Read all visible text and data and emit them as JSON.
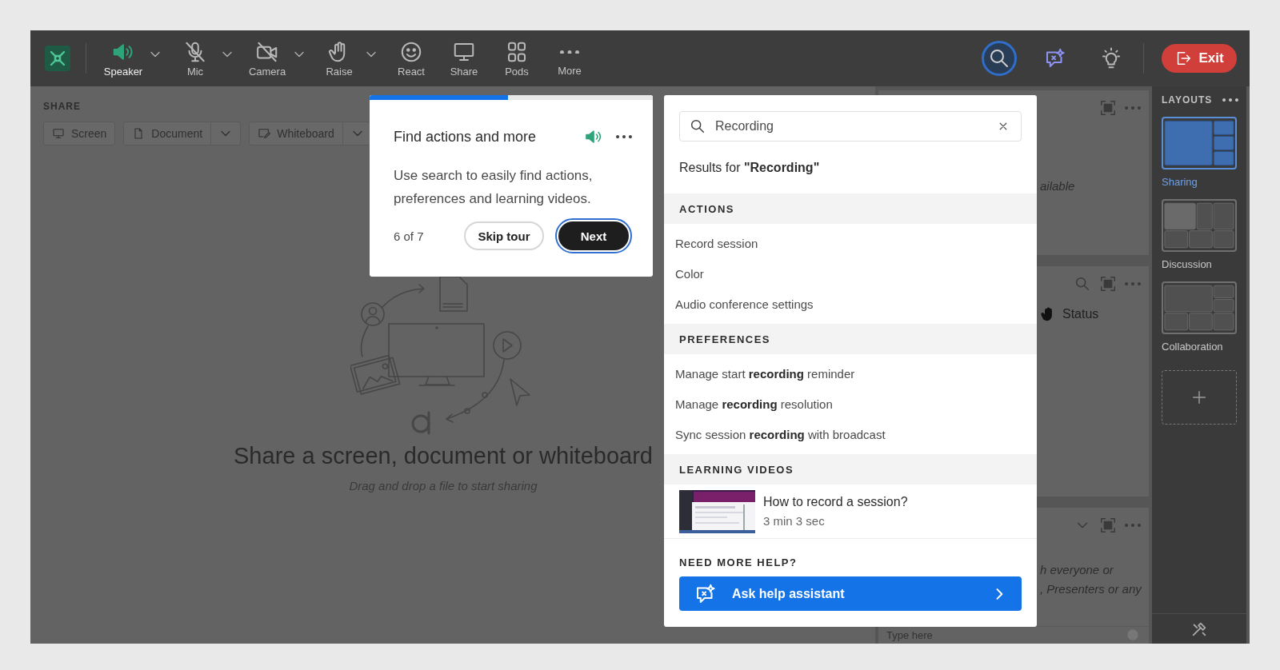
{
  "toolbar": {
    "items": [
      {
        "label": "Speaker",
        "kind": "speaker",
        "on": true,
        "has_menu": true
      },
      {
        "label": "Mic",
        "kind": "mic",
        "on": false,
        "has_menu": true
      },
      {
        "label": "Camera",
        "kind": "camera",
        "on": false,
        "has_menu": true
      },
      {
        "label": "Raise",
        "kind": "raise",
        "has_menu": true
      },
      {
        "label": "React",
        "kind": "react",
        "has_menu": false
      },
      {
        "label": "Share",
        "kind": "share",
        "has_menu": false
      },
      {
        "label": "Pods",
        "kind": "pods",
        "has_menu": false
      },
      {
        "label": "More",
        "kind": "more",
        "has_menu": false
      }
    ],
    "tools": [
      {
        "kind": "search",
        "selected": true
      },
      {
        "kind": "assistant",
        "selected": false
      },
      {
        "kind": "tips",
        "selected": false
      }
    ],
    "exit": "Exit"
  },
  "share": {
    "title": "SHARE",
    "buttons": [
      {
        "label": "Screen",
        "kind": "screen",
        "has_menu": false
      },
      {
        "label": "Document",
        "kind": "document",
        "has_menu": true
      },
      {
        "label": "Whiteboard",
        "kind": "whiteboard",
        "has_menu": true
      }
    ],
    "empty_title": "Share a screen, document or whiteboard",
    "empty_hint": "Drag and drop a file to start sharing"
  },
  "pods": [
    {
      "controls": [
        {
          "kind": "fullscreen"
        },
        {
          "kind": "more"
        }
      ],
      "lines": [
        "ailable"
      ]
    },
    {
      "controls": [
        {
          "kind": "search"
        },
        {
          "kind": "fullscreen"
        },
        {
          "kind": "more"
        }
      ],
      "status": "Status"
    },
    {
      "controls": [
        {
          "kind": "collapse"
        },
        {
          "kind": "fullscreen"
        },
        {
          "kind": "more"
        }
      ],
      "lines": [
        "h everyone or",
        ", Presenters or any"
      ],
      "input": {
        "placeholder": "Type here"
      }
    }
  ],
  "layouts": {
    "title": "LAYOUTS",
    "items": [
      {
        "label": "Sharing",
        "kind": "sharing",
        "selected": true
      },
      {
        "label": "Discussion",
        "kind": "discussion",
        "selected": false
      },
      {
        "label": "Collaboration",
        "kind": "collaboration",
        "selected": false
      }
    ]
  },
  "tour": {
    "level": 0.49,
    "title": "Find actions and more",
    "body": "Use search to easily find actions, preferences and learning videos.",
    "step": "6 of 7",
    "skip": "Skip tour",
    "next": "Next"
  },
  "search": {
    "query": "Recording",
    "results_title": "Results for **\"Recording\"**",
    "sections": [
      {
        "title": "ACTIONS",
        "kind": "list",
        "items": [
          "Record session",
          "Color",
          "Audio conference settings"
        ]
      },
      {
        "title": "PREFERENCES",
        "kind": "list",
        "items": [
          "Manage start **recording** reminder",
          "Manage **recording** resolution",
          "Sync session **recording** with broadcast"
        ]
      },
      {
        "title": "LEARNING VIDEOS",
        "kind": "videos",
        "videos": [
          {
            "title": "How to record a session?",
            "duration": "3 min 3 sec",
            "kind": "picture"
          }
        ]
      }
    ],
    "help_title": "NEED MORE HELP?",
    "help_button": "Ask help assistant"
  }
}
